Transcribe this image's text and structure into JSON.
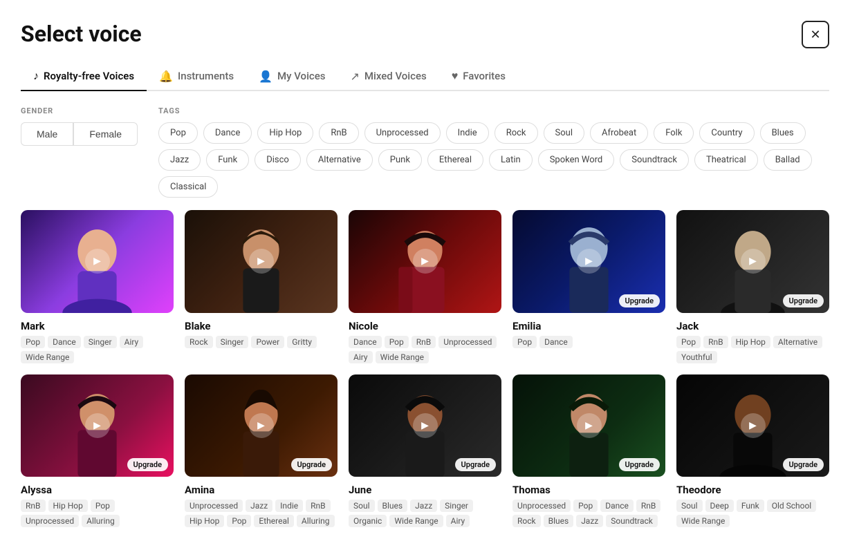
{
  "page": {
    "title": "Select voice"
  },
  "tabs": [
    {
      "id": "royalty-free",
      "label": "Royalty-free Voices",
      "icon": "♪",
      "active": true
    },
    {
      "id": "instruments",
      "label": "Instruments",
      "icon": "🔔",
      "active": false
    },
    {
      "id": "my-voices",
      "label": "My Voices",
      "icon": "👤",
      "active": false
    },
    {
      "id": "mixed-voices",
      "label": "Mixed Voices",
      "icon": "↗",
      "active": false
    },
    {
      "id": "favorites",
      "label": "Favorites",
      "icon": "♥",
      "active": false
    }
  ],
  "filters": {
    "gender": {
      "label": "GENDER",
      "options": [
        "Male",
        "Female"
      ]
    },
    "tags": {
      "label": "TAGS",
      "items": [
        "Pop",
        "Dance",
        "Hip Hop",
        "RnB",
        "Unprocessed",
        "Indie",
        "Rock",
        "Soul",
        "Afrobeat",
        "Folk",
        "Country",
        "Blues",
        "Jazz",
        "Funk",
        "Disco",
        "Alternative",
        "Punk",
        "Ethereal",
        "Latin",
        "Spoken Word",
        "Soundtrack",
        "Theatrical",
        "Ballad",
        "Classical"
      ]
    }
  },
  "voices": [
    {
      "name": "Mark",
      "bg": "bg-purple",
      "tags": [
        "Pop",
        "Dance",
        "Singer",
        "Airy",
        "Wide Range"
      ],
      "upgrade": false
    },
    {
      "name": "Blake",
      "bg": "bg-dark-warm",
      "tags": [
        "Rock",
        "Singer",
        "Power",
        "Gritty"
      ],
      "upgrade": false
    },
    {
      "name": "Nicole",
      "bg": "bg-red-dark",
      "tags": [
        "Dance",
        "Pop",
        "RnB",
        "Unprocessed",
        "Airy",
        "Wide Range"
      ],
      "upgrade": false
    },
    {
      "name": "Emilia",
      "bg": "bg-blue",
      "tags": [
        "Pop",
        "Dance"
      ],
      "upgrade": true
    },
    {
      "name": "Jack",
      "bg": "bg-gray-dark",
      "tags": [
        "Pop",
        "RnB",
        "Hip Hop",
        "Alternative",
        "Youthful"
      ],
      "upgrade": true
    },
    {
      "name": "Alyssa",
      "bg": "bg-pink",
      "tags": [
        "RnB",
        "Hip Hop",
        "Pop",
        "Unprocessed",
        "Alluring"
      ],
      "upgrade": true
    },
    {
      "name": "Amina",
      "bg": "bg-warm-brown",
      "tags": [
        "Unprocessed",
        "Jazz",
        "Indie",
        "RnB",
        "Hip Hop",
        "Pop",
        "Ethereal",
        "Alluring"
      ],
      "upgrade": true
    },
    {
      "name": "June",
      "bg": "bg-dark-face",
      "tags": [
        "Soul",
        "Blues",
        "Jazz",
        "Singer",
        "Organic",
        "Wide Range",
        "Airy"
      ],
      "upgrade": true
    },
    {
      "name": "Thomas",
      "bg": "bg-green-dark",
      "tags": [
        "Unprocessed",
        "Pop",
        "Dance",
        "RnB",
        "Rock",
        "Blues",
        "Jazz",
        "Soundtrack"
      ],
      "upgrade": true
    },
    {
      "name": "Theodore",
      "bg": "bg-black",
      "tags": [
        "Soul",
        "Deep",
        "Funk",
        "Old School",
        "Wide Range"
      ],
      "upgrade": true
    }
  ],
  "labels": {
    "upgrade": "Upgrade"
  }
}
